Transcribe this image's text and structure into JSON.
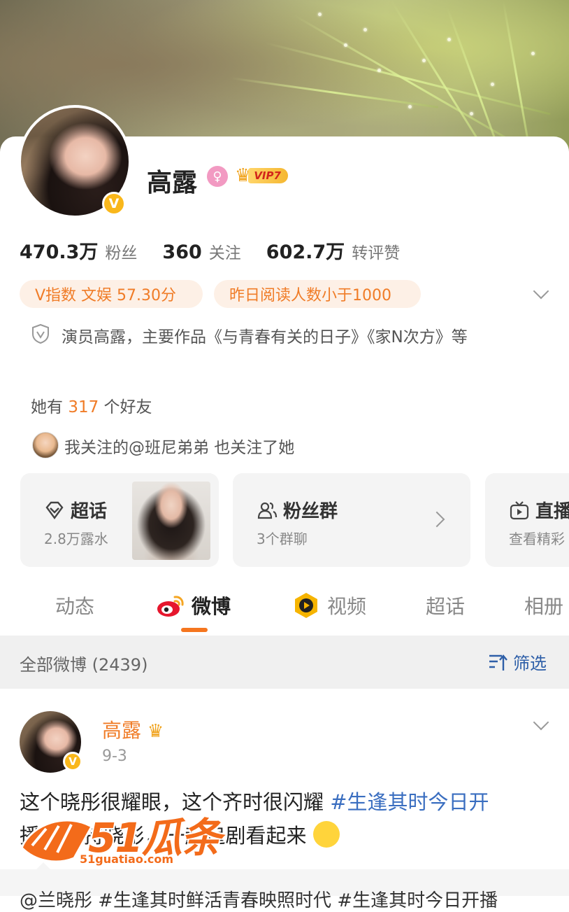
{
  "profile": {
    "name": "高露",
    "gender_symbol": "♀",
    "vip_label": "VIP7",
    "verified_badge": "V",
    "stats": [
      {
        "value": "470.3万",
        "label": "粉丝"
      },
      {
        "value": "360",
        "label": "关注"
      },
      {
        "value": "602.7万",
        "label": "转评赞"
      }
    ],
    "pills": [
      "V指数 文娱 57.30分",
      "昨日阅读人数小于1000"
    ],
    "bio": "演员高露，主要作品《与青春有关的日子》《家N次方》等",
    "friends": {
      "prefix": "她有 ",
      "count": "317",
      "suffix": " 个好友"
    },
    "mutual": "我关注的@班尼弟弟 也关注了她"
  },
  "tiles": [
    {
      "title": "超话",
      "subtitle": "2.8万露水",
      "icon": "diamond-icon"
    },
    {
      "title": "粉丝群",
      "subtitle": "3个群聊",
      "icon": "group-icon"
    },
    {
      "title": "直播",
      "subtitle": "查看精彩",
      "icon": "tv-icon"
    }
  ],
  "tabs": [
    {
      "label": "动态",
      "active": false
    },
    {
      "label": "微博",
      "active": true,
      "icon": "weibo-icon"
    },
    {
      "label": "视频",
      "active": false,
      "icon": "video-play-icon"
    },
    {
      "label": "超话",
      "active": false
    },
    {
      "label": "相册",
      "active": false
    }
  ],
  "filter": {
    "left": "全部微博 (2439)",
    "right": "筛选"
  },
  "post": {
    "author": "高露",
    "date": "9-3",
    "text_before": "这个晓彤很耀眼，这个齐时很闪耀 ",
    "topic": "#生逢其时今日开",
    "text_after": "播# 支持晓彤，一起追剧看起来"
  },
  "repost_preview": "@兰晓彤 #生逢其时鲜活青春映照时代 #生逢其时今日开播",
  "watermark": {
    "big": "51瓜条",
    "small": "51guatiao.com"
  },
  "colors": {
    "accent": "#f5761f",
    "link": "#3a6ec0",
    "verified": "#f9b71b"
  }
}
